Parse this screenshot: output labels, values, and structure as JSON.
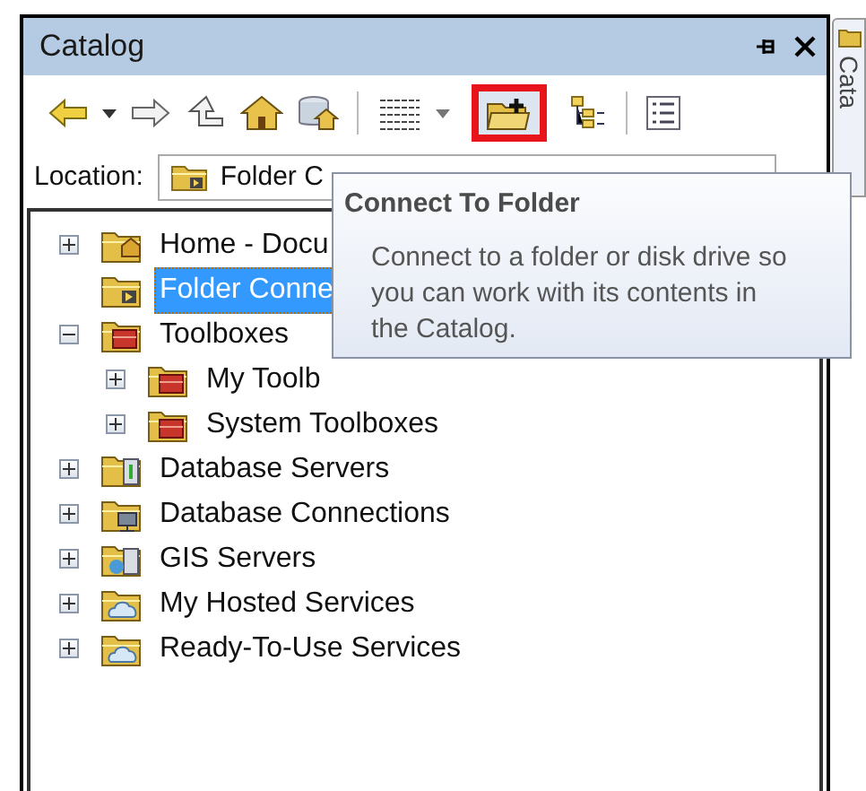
{
  "window": {
    "title": "Catalog"
  },
  "toolbar": [
    {
      "highlighted": false
    },
    {
      "highlighted": false
    },
    {
      "highlighted": false
    },
    {
      "highlighted": false
    },
    {
      "highlighted": false
    },
    {
      "highlighted": false
    },
    {
      "highlighted": false
    },
    {
      "highlighted": false
    },
    {
      "highlighted": true
    },
    {
      "highlighted": false
    },
    {
      "highlighted": false
    }
  ],
  "location": {
    "label": "Location:",
    "value": "Folder C"
  },
  "tree": [
    {
      "label": "Home - Docu",
      "expanded": false,
      "selected": false
    },
    {
      "label": "Folder Conne",
      "selected": true
    },
    {
      "label": "Toolboxes",
      "expanded": true,
      "selected": false,
      "children": [
        {
          "label": "My Toolb",
          "expanded": false,
          "selected": false
        },
        {
          "label": "System Toolboxes",
          "expanded": false,
          "selected": false
        }
      ]
    },
    {
      "label": "Database Servers",
      "expanded": false,
      "selected": false
    },
    {
      "label": "Database Connections",
      "expanded": false,
      "selected": false
    },
    {
      "label": "GIS Servers",
      "expanded": false,
      "selected": false
    },
    {
      "label": "My Hosted Services",
      "expanded": false,
      "selected": false
    },
    {
      "label": "Ready-To-Use Services",
      "expanded": false,
      "selected": false
    }
  ],
  "tooltip": {
    "title": "Connect To Folder",
    "text": "Connect to a folder or disk drive so you can work with its contents in the Catalog."
  },
  "side_tab": {
    "label": "Cata"
  }
}
